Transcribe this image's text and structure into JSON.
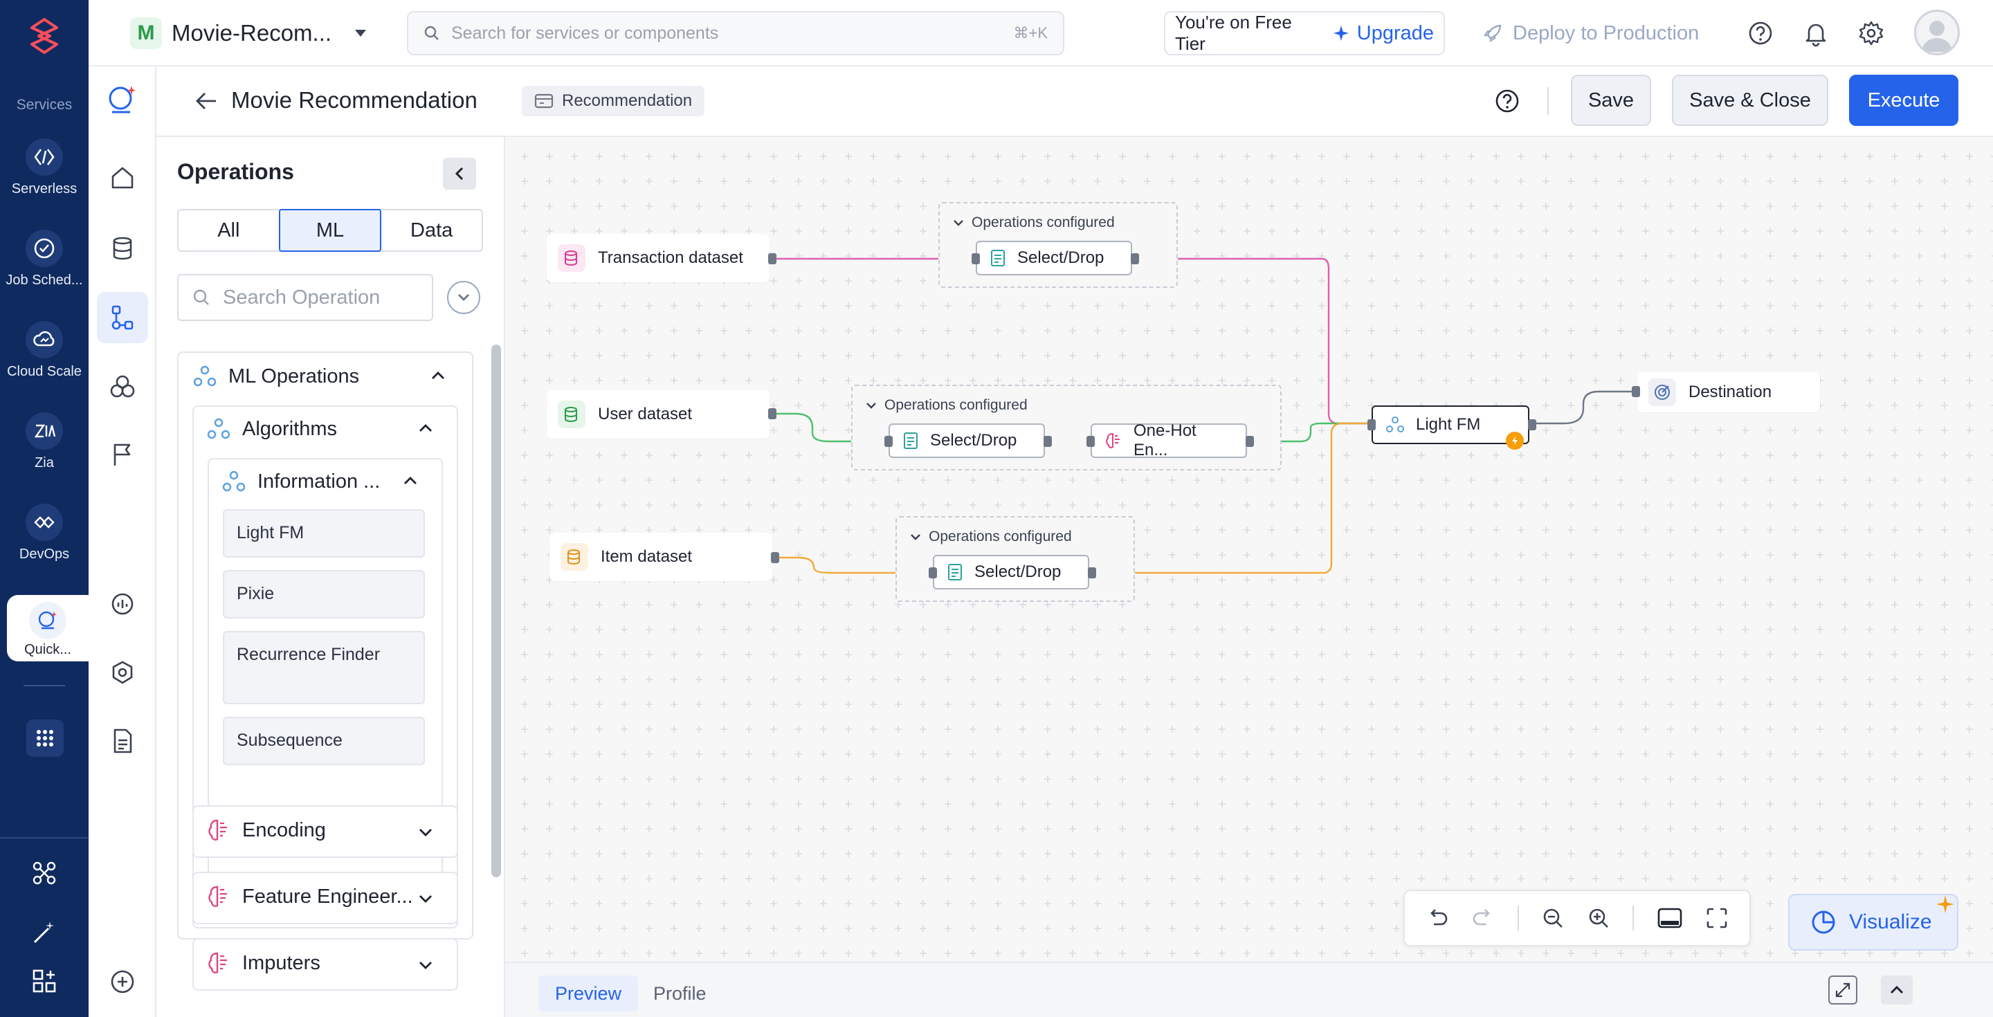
{
  "rail": {
    "section_label": "Services",
    "items": [
      {
        "label": "Serverless",
        "icon": "serverless-icon"
      },
      {
        "label": "Job Sched...",
        "icon": "job-scheduler-icon"
      },
      {
        "label": "Cloud Scale",
        "icon": "cloud-scale-icon"
      },
      {
        "label": "Zia",
        "icon": "zia-icon"
      },
      {
        "label": "DevOps",
        "icon": "devops-icon"
      },
      {
        "label": "Quick...",
        "icon": "quickml-icon"
      }
    ]
  },
  "header": {
    "project_initial": "M",
    "project_name": "Movie-Recom...",
    "search_placeholder": "Search for services or components",
    "search_shortcut": "⌘+K",
    "tier_text": "You're on Free Tier",
    "upgrade_label": "Upgrade",
    "deploy_label": "Deploy to Production"
  },
  "subheader": {
    "title": "Movie Recommendation",
    "tag": "Recommendation",
    "save_label": "Save",
    "save_close_label": "Save & Close",
    "execute_label": "Execute"
  },
  "operations": {
    "title": "Operations",
    "tabs": [
      "All",
      "ML",
      "Data"
    ],
    "active_tab": "ML",
    "search_placeholder": "Search Operation",
    "ml_operations_label": "ML Operations",
    "algorithms_label": "Algorithms",
    "information_label": "Information ...",
    "items": [
      "Light FM",
      "Pixie",
      "Recurrence Finder",
      "Subsequence"
    ],
    "encoding_label": "Encoding",
    "feature_engineering_label": "Feature Engineer...",
    "imputers_label": "Imputers"
  },
  "canvas": {
    "datasets": {
      "transaction": "Transaction dataset",
      "user": "User dataset",
      "item": "Item dataset"
    },
    "group_label": "Operations configured",
    "ops": {
      "select_drop": "Select/Drop",
      "one_hot": "One-Hot En..."
    },
    "model_label": "Light FM",
    "destination_label": "Destination",
    "colors": {
      "transaction": "#e05fb0",
      "user": "#4fbf6b",
      "item": "#f2a93b",
      "output": "#6f7785"
    }
  },
  "visualize_label": "Visualize",
  "bottom_tabs": {
    "preview": "Preview",
    "profile": "Profile"
  }
}
